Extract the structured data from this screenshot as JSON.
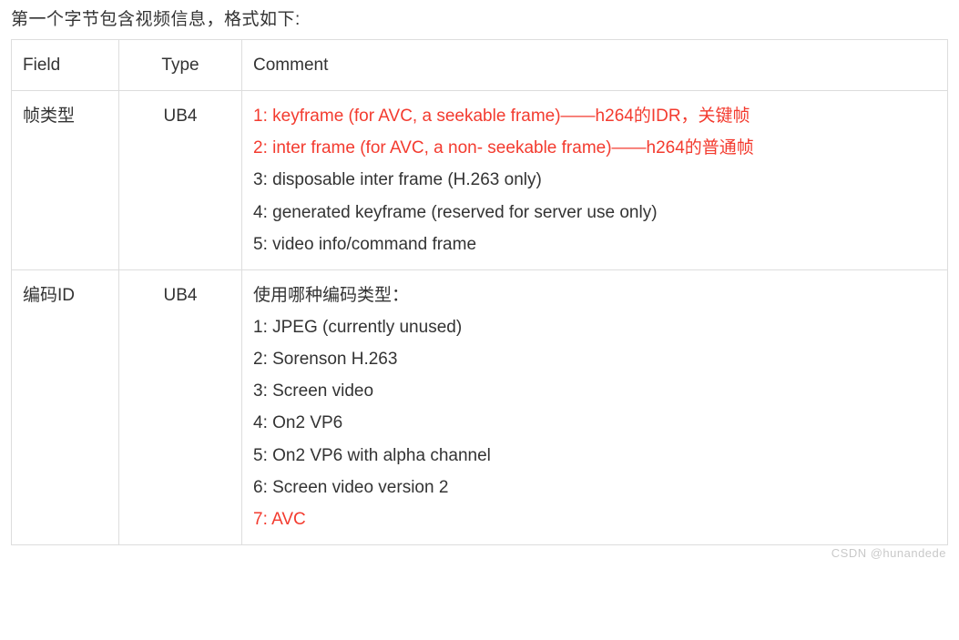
{
  "intro": "第一个字节包含视频信息，格式如下:",
  "columns": {
    "field": "Field",
    "type": "Type",
    "comment": "Comment"
  },
  "rows": [
    {
      "field": "帧类型",
      "type": "UB4",
      "comment_lines": [
        {
          "text": "1: keyframe (for AVC, a seekable frame)——h264的IDR，关键帧",
          "highlight": true
        },
        {
          "text": "2: inter frame (for AVC, a non- seekable frame)——h264的普通帧",
          "highlight": true
        },
        {
          "text": "3: disposable inter frame (H.263 only)",
          "highlight": false
        },
        {
          "text": "4: generated keyframe (reserved for server use only)",
          "highlight": false
        },
        {
          "text": "5: video info/command frame",
          "highlight": false
        }
      ]
    },
    {
      "field": "编码ID",
      "type": "UB4",
      "comment_lines": [
        {
          "text": "使用哪种编码类型：",
          "highlight": false
        },
        {
          "text": "1: JPEG (currently unused)",
          "highlight": false
        },
        {
          "text": "2: Sorenson H.263",
          "highlight": false
        },
        {
          "text": "3: Screen video",
          "highlight": false
        },
        {
          "text": "4: On2 VP6",
          "highlight": false
        },
        {
          "text": "5: On2 VP6 with alpha channel",
          "highlight": false
        },
        {
          "text": "6: Screen video version 2",
          "highlight": false
        },
        {
          "text": "7: AVC",
          "highlight": true
        }
      ]
    }
  ],
  "watermark": "CSDN @hunandede"
}
